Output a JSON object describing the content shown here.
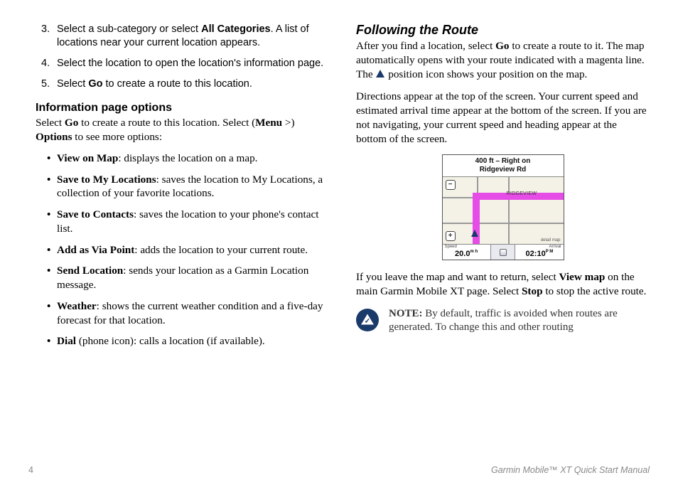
{
  "left": {
    "steps": [
      {
        "n": "3.",
        "pre": "Select a sub-category or select ",
        "bold": "All Categories",
        "post": ". A list of locations near your current location appears."
      },
      {
        "n": "4.",
        "pre": "Select the location to open the location's information page.",
        "bold": "",
        "post": ""
      },
      {
        "n": "5.",
        "pre": "Select ",
        "bold": "Go",
        "post": " to create a route to this location."
      }
    ],
    "info_heading": "Information page options",
    "info_intro_parts": {
      "a": "Select ",
      "b": "Go",
      "c": " to create a route to this location. Select (",
      "d": "Menu",
      "e": " >) ",
      "f": "Options",
      "g": " to see more options:"
    },
    "options": [
      {
        "b": "View on Map",
        "t": ": displays the location on a map."
      },
      {
        "b": "Save to My Locations",
        "t": ": saves the location to My Locations, a collection of your favorite locations."
      },
      {
        "b": "Save to Contacts",
        "t": ": saves the location to your phone's contact list."
      },
      {
        "b": "Add as Via Point",
        "t": ": adds the location to your current route."
      },
      {
        "b": "Send Location",
        "t": ": sends your location as a Garmin Location message."
      },
      {
        "b": "Weather",
        "t": ": shows the current weather condition and a five-day forecast for that location."
      },
      {
        "b": "Dial",
        "t": " (phone icon): calls a location (if available)."
      }
    ]
  },
  "right": {
    "heading": "Following the Route",
    "p1": {
      "a": "After you find a location, select ",
      "b": "Go",
      "c": " to create a route to it. The map automatically opens with your route indicated with a magenta line. The ",
      "d": " position icon shows your position on the map."
    },
    "p2": "Directions appear at the top of the screen. Your current speed and estimated arrival time appear at the bottom of the screen. If you are not navigating, your current speed and heading appear at the bottom of the screen.",
    "map": {
      "top_line1": "400 ft – Right on",
      "top_line2": "Ridgeview Rd",
      "ridgeview": "RIDGEVIEW",
      "minus": "−",
      "plus": "+",
      "detail": "detail map",
      "speed_label": "Speed",
      "speed_value": "20.0",
      "speed_unit": "m h",
      "arrival_label": "Arrival",
      "arrival_value": "02:10",
      "arrival_unit": "P M"
    },
    "p3": {
      "a": "If you leave the map and want to return, select ",
      "b": "View map",
      "c": " on the main Garmin Mobile XT page. Select ",
      "d": "Stop",
      "e": " to stop the active route."
    },
    "note": {
      "a": "NOTE:",
      "b": " By default, traffic is avoided when routes are generated. To change this and other routing"
    }
  },
  "footer": {
    "page": "4",
    "manual": "Garmin Mobile™ XT Quick Start Manual"
  }
}
